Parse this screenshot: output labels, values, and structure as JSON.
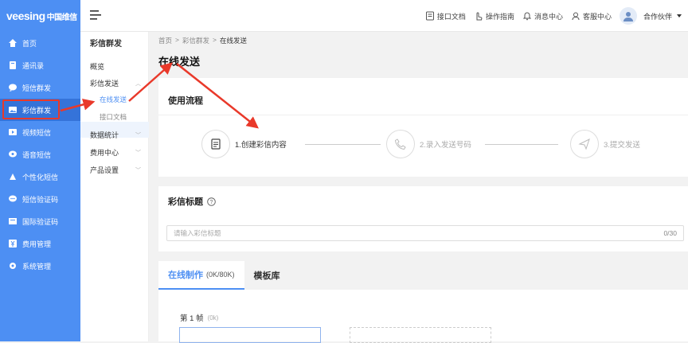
{
  "brand": {
    "logo": "veesing",
    "logo_sub": "中国维信"
  },
  "sidebar": {
    "items": [
      {
        "label": "首页",
        "icon": "home-icon"
      },
      {
        "label": "通讯录",
        "icon": "contacts-icon"
      },
      {
        "label": "短信群发",
        "icon": "sms-icon"
      },
      {
        "label": "彩信群发",
        "icon": "mms-icon",
        "active": true
      },
      {
        "label": "视频短信",
        "icon": "video-icon"
      },
      {
        "label": "语音短信",
        "icon": "voice-icon"
      },
      {
        "label": "个性化短信",
        "icon": "custom-icon"
      },
      {
        "label": "短信验证码",
        "icon": "code-icon"
      },
      {
        "label": "国际验证码",
        "icon": "intl-icon"
      },
      {
        "label": "费用管理",
        "icon": "yen-icon"
      },
      {
        "label": "系统管理",
        "icon": "gear-icon"
      }
    ]
  },
  "topbar": {
    "api_docs": "接口文档",
    "guide": "操作指南",
    "messages": "消息中心",
    "service": "客服中心",
    "partner": "合作伙伴"
  },
  "submenu": {
    "title": "彩信群发",
    "overview": "概览",
    "send": "彩信发送",
    "online_send": "在线发送",
    "api_docs": "接口文档",
    "stats": "数据统计",
    "fees": "费用中心",
    "settings": "产品设置"
  },
  "breadcrumb": {
    "home": "首页",
    "parent": "彩信群发",
    "current": "在线发送"
  },
  "page_title": "在线发送",
  "process": {
    "title": "使用流程",
    "steps": [
      "1.创建彩信内容",
      "2.录入发送号码",
      "3.提交发送"
    ]
  },
  "mms_title": {
    "label": "彩信标题",
    "placeholder": "请输入彩信标题",
    "counter": "0/30"
  },
  "tabs": {
    "online": "在线制作",
    "online_count": "(0K/80K)",
    "templates": "模板库"
  },
  "frame": {
    "label": "第 1 帧",
    "size": "(0k)"
  },
  "colors": {
    "primary": "#4d8ff3",
    "annotation": "#e9392a"
  }
}
